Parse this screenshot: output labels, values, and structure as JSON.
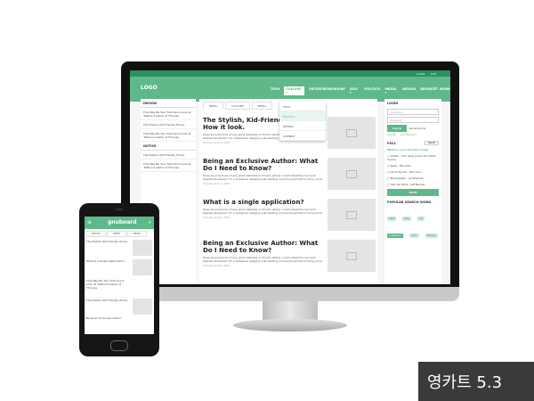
{
  "desktop": {
    "topbar": {
      "login": "LOGIN",
      "join": "JOIN"
    },
    "logo": "LOGO",
    "nav": [
      "TECH",
      "CULTURE ▾",
      "ENTREPRENEURSHIP",
      "SELF ▾",
      "POLITICS",
      "MEDIA ▾",
      "DESIGN",
      "SCIENCE",
      "WORK"
    ],
    "dropdown": [
      "TECH",
      "POLITICS",
      "DESIGN",
      "SCIENCE"
    ],
    "left_sidebar": {
      "section1": "DESIGN",
      "items1": [
        "This May Be Your First Good Look at 'Tethun's Game of Thrones",
        "The Stylish, Kid-Friendly Home.",
        "This May Be Your First Good Look at 'Tethun's Game of Thrones"
      ],
      "section2": "NOTICE",
      "items2": [
        "The Stylish, Kid-Friendly Home.",
        "This May Be Your First Good Look at 'Tethun's Game of Thrones"
      ]
    },
    "tabs": [
      "NEWS",
      "CULTURE",
      "MEDIA"
    ],
    "posts": [
      {
        "title": "The Stylish, Kid-Friendly Home. How it look.",
        "excerpt": "Does anyone know of any good websites or forums where I could advertise my work besides facebook? I'm a freelance designer just starting out and would like to bring more",
        "meta": "Unknown  April 21, 2016"
      },
      {
        "title": "Being an Exclusive Author: What Do I Need to Know?",
        "excerpt": "Does anyone know of any good websites or forums where I could advertise my work besides facebook? I'm a freelance designer just starting out and would like to bring more",
        "meta": "Unknown  April 21, 2016"
      },
      {
        "title": "What is a single application?",
        "excerpt": "Does anyone know of any good websites or forums where I could advertise my work besides facebook? I'm a freelance designer just starting out and would like to bring more",
        "meta": "Unknown  April 21, 2016"
      },
      {
        "title": "Being an Exclusive Author: What Do I Need to Know?",
        "excerpt": "Does anyone know of any good websites or forums where I could advertise my work besides facebook? I'm a freelance designer just starting out and would like to bring more",
        "meta": "Unknown  April 21, 2016"
      }
    ],
    "right_sidebar": {
      "login_title": "LOGIN",
      "username": "Username",
      "password": "Password",
      "login_btn": "Log In",
      "remember": "Remember Me",
      "register": "Register",
      "lost": "Lost Password",
      "poll_title": "POLL",
      "poll_result": "Result",
      "poll_question": "What is your favorite song?",
      "options": [
        "Coldie - Your Sing Loves You (Feat. Crush)",
        "Spell - Pay Kids",
        "All of My life - Park won",
        "Photograph - ed Sheeran",
        "Call You Mine - Jeff Bernat"
      ],
      "vote": "VOTE",
      "popular": "POPULAR SEARCH WORD",
      "tags": [
        "2016",
        "blog",
        "cat",
        "conference",
        "Color",
        "element"
      ]
    }
  },
  "mobile": {
    "logo": "gnuboard",
    "tabs": [
      "NOTICE",
      "NEWS",
      "MEDIA"
    ],
    "items": [
      "The Stylish, Kid-Friendly Home.",
      "What is a single application?",
      "This May Be Your First Good Look at 'Tethun's Game of Thrones",
      "The Stylish, Kid-Friendly Home.",
      "Being an Exclusive Author"
    ]
  },
  "badge": "영카트 5.3"
}
